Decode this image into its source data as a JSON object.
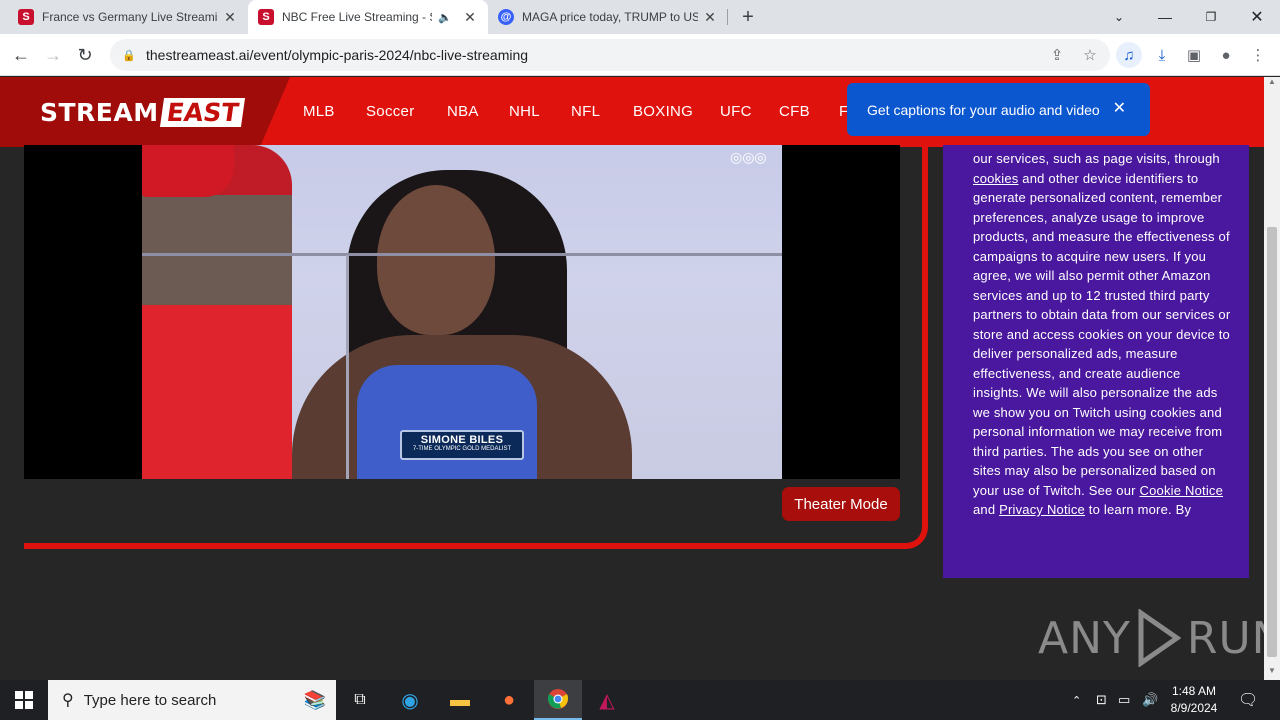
{
  "browser": {
    "tabs": [
      {
        "title": "France vs Germany Live Streamin",
        "favicon": "S",
        "favicon_color": "#c8102e",
        "active": false
      },
      {
        "title": "NBC Free Live Streaming - S",
        "favicon": "S",
        "favicon_color": "#c8102e",
        "active": true,
        "audio": true
      },
      {
        "title": "MAGA price today, TRUMP to US",
        "favicon": "@",
        "favicon_color": "#3861fb",
        "active": false
      }
    ],
    "url": "thestreameast.ai/event/olympic-paris-2024/nbc-live-streaming"
  },
  "site": {
    "logo_left": "STREAM",
    "logo_right": "EAST",
    "nav": [
      "MLB",
      "Soccer",
      "NBA",
      "NHL",
      "NFL",
      "BOXING",
      "UFC",
      "CFB",
      "F"
    ]
  },
  "video": {
    "name_line": "SIMONE BILES",
    "sub_line": "7-TIME OLYMPIC GOLD MEDALIST"
  },
  "theater_mode_label": "Theater Mode",
  "captions_popup": {
    "text": "Get captions for your audio and video"
  },
  "consent": {
    "p1": "our services, such as page visits, through ",
    "link1": "cookies",
    "p2": " and other device identifiers to generate personalized content, remember preferences, analyze usage to improve products, and measure the effectiveness of campaigns to acquire new users. If you agree, we will also permit other Amazon services and up to 12 trusted third party partners to obtain data from our services or store and access cookies on your device to deliver personalized ads, measure effectiveness, and create audience insights. We will also personalize the ads we show you on Twitch using cookies and personal information we may receive from third parties. The ads you see on other sites may also be personalized based on your use of Twitch. See our ",
    "link2": "Cookie Notice",
    "p3": " and ",
    "link3": "Privacy Notice",
    "p4": " to learn more. By"
  },
  "watermark": {
    "left": "ANY",
    "right": "RUN"
  },
  "taskbar": {
    "search_placeholder": "Type here to search",
    "time": "1:48 AM",
    "date": "8/9/2024"
  }
}
